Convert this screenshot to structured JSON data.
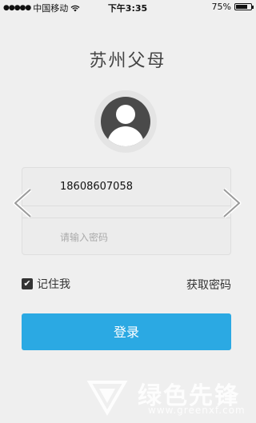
{
  "status": {
    "carrier": "中国移动",
    "time": "下午3:35",
    "battery": "75%",
    "battery_level": 0.75
  },
  "app": {
    "title": "苏州父母"
  },
  "login": {
    "username": "18608607058",
    "password_placeholder": "请输入密码",
    "remember_label": "记住我",
    "get_password_label": "获取密码",
    "submit_label": "登录"
  },
  "watermark": {
    "text": "绿色先锋",
    "sub": "www.greenxf.com"
  },
  "colors": {
    "accent": "#2ba9e3",
    "background": "#efefef"
  }
}
